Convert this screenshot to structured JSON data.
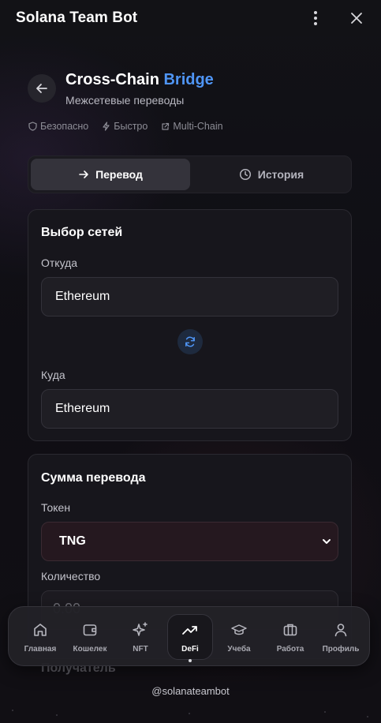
{
  "window": {
    "title": "Solana Team Bot"
  },
  "header": {
    "title_main": "Cross-Chain ",
    "title_accent": "Bridge",
    "subtitle": "Межсетевые переводы",
    "features": [
      {
        "icon": "shield-icon",
        "label": "Безопасно"
      },
      {
        "icon": "lightning-icon",
        "label": "Быстро"
      },
      {
        "icon": "external-link-icon",
        "label": "Multi-Chain"
      }
    ]
  },
  "tabs": [
    {
      "label": "Перевод",
      "icon": "arrow-right-icon",
      "active": true
    },
    {
      "label": "История",
      "icon": "clock-icon",
      "active": false
    }
  ],
  "networks": {
    "title": "Выбор сетей",
    "from_label": "Откуда",
    "from_value": "Ethereum",
    "to_label": "Куда",
    "to_value": "Ethereum"
  },
  "amount": {
    "title": "Сумма перевода",
    "token_label": "Токен",
    "token_value": "TNG",
    "quantity_label": "Количество",
    "quantity_placeholder": "0.00",
    "recipient_label": "Получатель"
  },
  "nav": [
    {
      "label": "Главная",
      "icon": "home-icon",
      "active": false
    },
    {
      "label": "Кошелек",
      "icon": "wallet-icon",
      "active": false
    },
    {
      "label": "NFT",
      "icon": "sparkles-icon",
      "active": false
    },
    {
      "label": "DeFi",
      "icon": "trending-up-icon",
      "active": true
    },
    {
      "label": "Учеба",
      "icon": "graduation-cap-icon",
      "active": false
    },
    {
      "label": "Работа",
      "icon": "briefcase-icon",
      "active": false
    },
    {
      "label": "Профиль",
      "icon": "user-icon",
      "active": false
    }
  ],
  "footer": {
    "handle": "@solanateambot"
  },
  "colors": {
    "accent": "#4f95f5",
    "background": "#0d0d12"
  }
}
